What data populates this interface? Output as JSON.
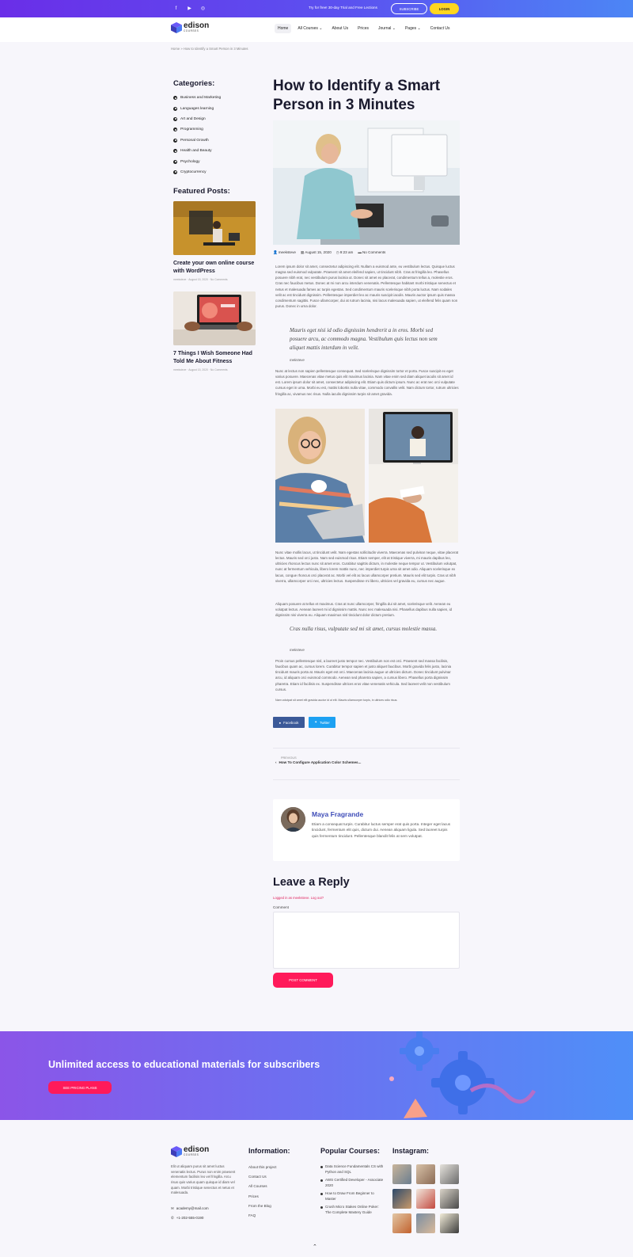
{
  "topbar": {
    "social_icons": [
      "facebook-icon",
      "youtube-icon",
      "instagram-icon"
    ],
    "trial_text": "Try for free! 30-day Trial and Free Lections",
    "subscribe_label": "SUBSCRIBE",
    "login_label": "LOGIN"
  },
  "header": {
    "brand": "edison",
    "brand_sub": "COURSES",
    "nav": [
      {
        "label": "Home"
      },
      {
        "label": "All Courses ⌄"
      },
      {
        "label": "About Us"
      },
      {
        "label": "Prices"
      },
      {
        "label": "Journal ⌄"
      },
      {
        "label": "Pages ⌄"
      },
      {
        "label": "Contact Us"
      }
    ]
  },
  "breadcrumb": "Home » How to Identify a Smart Person in 3 Minutes",
  "sidebar": {
    "categories_title": "Categories:",
    "categories": [
      "Business and Marketing",
      "Languages learning",
      "Art and Design",
      "Programming",
      "Personal Growth",
      "Health and Beauty",
      "Psychology",
      "Cryptocurrency"
    ],
    "featured_title": "Featured Posts:",
    "featured": [
      {
        "title": "Create your own online course with WordPress",
        "meta": "meeksteve · August 15, 2020 · No Comments"
      },
      {
        "title": "7 Things I Wish Someone Had Told Me About Fitness",
        "meta": "meeksteve · August 15, 2020 · No Comments"
      }
    ]
  },
  "post": {
    "title": "How to Identify a Smart Person in 3 Minutes",
    "meta": {
      "author": "meeksteve",
      "date": "August 15, 2020",
      "time": "9:23 am",
      "comments": "No Comments"
    },
    "p1": "Lorem ipsum dolor sit amet, consectetur adipiscing elit. Nullam a euismod ante, eu vestibulum lectus. Quisque luctus magna sed euismod vulputate. Praesent sit amet eleifend sapien, ut tincidunt nibh. Cras at fringilla leo. Phasellus posuere nibh erat, nec vestibulum purus lacinia ut. Donec sit amet ex placerat, condimentum tellus a, molestie eros. Cras nec faucibus metus. Donec at mi non arcu interdum venenatis. Pellentesque habitant morbi tristique senectus et netus et malesuada fames ac turpis egestas. Sed condimentum mauris scelerisque nibh porta luctus. Nam sodales velit ac est tincidunt dignissim. Pellentesque imperdiet leo ac mauris suscipit iaculis. Mauris auctor ipsum quis massa condimentum sagittis. Fusce ullamcorper, dui at rutrum lacinia, nisi lacus malesuada sapien, ut eleifend felis quam non purus. Donec in urna dolor.",
    "quote1": "Mauris eget nisi id odio dignissim hendrerit a in eros. Morbi sed posuere arcu, ac commodo magna. Vestibulum quis lectus non sem aliquet mattis interdum in velit.",
    "quote1_by": "meksteve",
    "p2": "Nunc at lectus non sapien pellentesque consequat. Sed scelerisque dignissim tortor et porta. Fusce suscipit ex eget varius posuere. Maecenas vitae metus quis elit maximus lacinia. Nam vitae enim sed diam aliquet iaculis sit amet id est. Lorem ipsum dolor sit amet, consectetur adipiscing elit. Etiam quis dictum ipsum. Nunc ac erat nec orci vulputate cursus eget in urna. Morbi eu est, mattis lobortis nulla vitae, commodo convallis velit. Nam dictum tortor, rutrum ultricies fringilla ac, vivamus nec risus. Nulla iaculis dignissim turpis sit amet gravida.",
    "p3": "Nunc vitae mollis lacus, ut tincidunt velit. Nam egestas sollicitudin viverra. Maecenas sed pulvinar neque, vitae placerat lectus. Mauris sed orci justo. Nam sed euismod risus. Etiam semper, elit at tristique viverra, mi mauris dapibus leo, ultricies rhoncus lectus nunc sit amet eros. Curabitur sagittis dictum, in molestie neque tempor ut. Vestibulum volutpat, nunc at fermentum vehicula, libero lorem mattis nunc, nec imperdiet turpis urna sit amet odio. Aliquam scelerisque ex lacus, congue rhoncus orci placerat ac. Morbi vel elit ac lacus ullamcorper pretium. Mauris sed elit turpis. Cras ut nibh viverra, ullamcorper orci nec, ultricies lectus. Suspendisse mi libero, ultricies vel gravida eu, cursus nec augue.",
    "p4": "Aliquam posuere at tellus et maximus. Cras at nunc ullamcorper, fringilla dui sit amet, scelerisque velit. Aenean eu volutpat lectus. Aenean laoreet mi id dignissim mattis. Nunc nec malesuada nisi. Phasellus dapibus nulla sapien, id dignissim nisi viverra eu. Aliquam maximus nisl tincidunt dolor dictum pretium.",
    "quote2": "Cras nulla risus, vulputate sed mi sit amet, cursus molestie massa.",
    "quote2_by": "meksteve",
    "p5": "Proin cursus pellentesque nisl, a laoreet justo tempor nec. Vestibulum non est orci. Praesent sed massa facilisis, faucibus quam ac, cursus lorem. Curabitur tempor sapien et justo aliquet faucibus. Morbi gravida felis justo, lacinia tincidunt mauris porta at. Mauris eget est orci. Maecenas lacinia augue ut ultricies dictum. Donec tincidunt pulvinar arcu, id aliquam orci euismod commodo. Aenean sed pharetra sapien, a cursus libero. Phasellus porta dignissim pharetra. Etiam id facilisis ex. Suspendisse ultrices eros vitae venenatis vehicula. Sed laoreet velit non vestibulum cursus.",
    "p6": "Nam volutpat sit amet elit gravida auctor id ut elit. Mauris ullamcorper turpis, in ultrices odio risus."
  },
  "share": {
    "facebook": "Facebook",
    "twitter": "Twitter"
  },
  "prev_post": {
    "label": "PREVIOUS",
    "title": "How To Configure Application Color Schemes..."
  },
  "author": {
    "name": "Maya Fragrande",
    "bio": "Etiam a consequat turpis. Curabitur luctus semper erat quis porta. Integer eget lacus tincidunt, fermentum elit quis, dictum dui. Aenean aliquam ligula. Sed laoreet turpis quis fermentum tincidunt. Pellentesque blandit felis at sem volutpat."
  },
  "reply": {
    "title": "Leave a Reply",
    "logged_in": "Logged in as meeksteve. Log out?",
    "comment_label": "Comment",
    "button": "POST COMMENT"
  },
  "banner": {
    "text": "Unlimited access to educational materials for subscribers",
    "button": "SEE PRICING PLANS"
  },
  "footer": {
    "brand": "edison",
    "brand_sub": "COURSES",
    "desc": "Elit ut aliquam purus sit amet luctus venenatis lectus. Purus non enim praesent elementum facilisis leo vel fringilla. Arcu risus quis varius quam quisque id diam vel quam. Morbi tristique senectus et netus et malesuada.",
    "email": "academy@mail.com",
    "phone": "+1-202-555-0190",
    "info_title": "Information:",
    "info_links": [
      "About this project",
      "Contact Us",
      "All Courses",
      "Prices",
      "From the Blog",
      "FAQ"
    ],
    "courses_title": "Popular Courses:",
    "courses": [
      "Data Science Fundamentals CS with Python and SQL",
      "AWS Certified Developer - Associate 2020",
      "How to Draw From Beginner to Master",
      "Crush Micro Stakes Online Poker: The Complete Mastery Guide"
    ],
    "instagram_title": "Instagram:"
  }
}
